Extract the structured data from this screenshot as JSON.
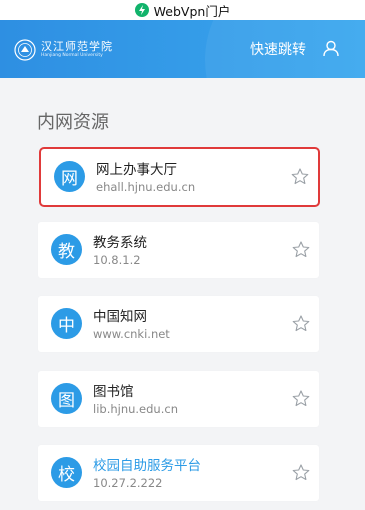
{
  "status": {
    "app_title": "WebVpn门户"
  },
  "header": {
    "logo_cn": "汉江师范学院",
    "logo_en": "Hanjiang Normal University",
    "quick_jump": "快速跳转"
  },
  "section": {
    "title": "内网资源"
  },
  "resources": [
    {
      "badge": "网",
      "name": "网上办事大厅",
      "address": "ehall.hjnu.edu.cn"
    },
    {
      "badge": "教",
      "name": "教务系统",
      "address": "10.8.1.2"
    },
    {
      "badge": "中",
      "name": "中国知网",
      "address": "www.cnki.net"
    },
    {
      "badge": "图",
      "name": "图书馆",
      "address": "lib.hjnu.edu.cn"
    },
    {
      "badge": "校",
      "name": "校园自助服务平台",
      "address": "10.27.2.222"
    }
  ],
  "colors": {
    "header": "#2f9ae7",
    "badge": "#2c9be6",
    "highlight": "#e03a3a",
    "accent_text": "#2c9be6"
  },
  "icons": {
    "status": "shield-icon",
    "user": "user-icon",
    "favorite": "star-outline-icon"
  }
}
